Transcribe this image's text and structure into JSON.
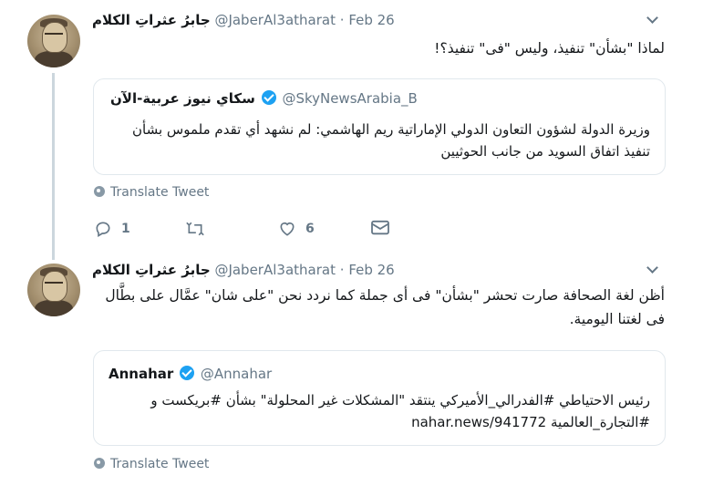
{
  "tweets": [
    {
      "author_name": "جابرُ عثراتِ الكلام",
      "handle": "@JaberAl3atharat",
      "separator": "·",
      "date": "Feb 26",
      "text": "لماذا \"بشأن\" تنفيذ، وليس \"فى\" تنفيذ؟!",
      "quote": {
        "author_name": "سكاي نيوز عربية-الآن",
        "handle": "@SkyNewsArabia_B",
        "text": "وزيرة الدولة لشؤون التعاون الدولي الإماراتية ريم الهاشمي: لم نشهد أي تقدم ملموس بشأن تنفيذ اتفاق السويد من جانب الحوثيين"
      },
      "translate_label": "Translate Tweet",
      "reply_count": "1",
      "retweet_count": "",
      "like_count": "6"
    },
    {
      "author_name": "جابرُ عثراتِ الكلام",
      "handle": "@JaberAl3atharat",
      "separator": "·",
      "date": "Feb 26",
      "text": "أظن لغة الصحافة صارت تحشر \"بشأن\" فى أى جملة كما نردد نحن \"على شان\" عمَّال على بطَّال فى لغتنا اليومية.",
      "quote": {
        "author_name": "Annahar",
        "handle": "@Annahar",
        "text": "رئيس الاحتياطي #الفدرالي_الأميركي ينتقد \"المشكلات غير المحلولة\" بشأن #بريكست و #التجارة_العالمية nahar.news/941772"
      },
      "translate_label": "Translate Tweet"
    }
  ],
  "icons": {
    "reply": "reply-icon",
    "retweet": "retweet-icon",
    "like": "heart-icon",
    "dm": "envelope-icon",
    "more": "chevron-down-icon",
    "translate": "globe-icon",
    "verified": "verified-badge-icon"
  },
  "colors": {
    "verified": "#1da1f2",
    "secondary_text": "#657786",
    "border": "#e1e8ed"
  }
}
